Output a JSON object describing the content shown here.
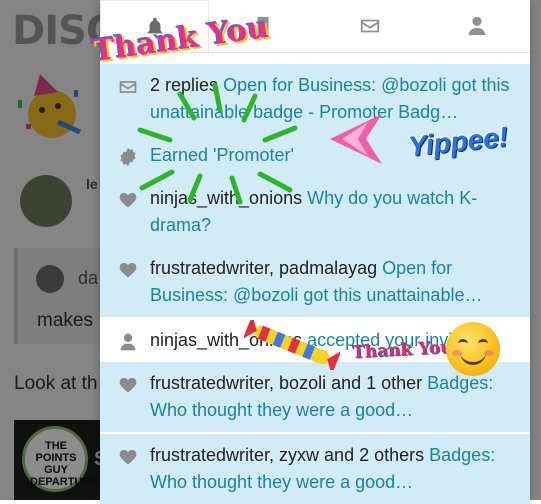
{
  "background": {
    "logo": "DISC",
    "author_partial": "le",
    "quote_author_partial": "da",
    "makes_text": "makes",
    "lookat_text": "Look at th",
    "points_guy_text": "THE POINTS GUY DEPARTURES",
    "extra_letter": "S"
  },
  "tabs": [
    {
      "name": "notifications",
      "icon": "bell-icon",
      "active": true
    },
    {
      "name": "bookmarks",
      "icon": "bookmark-icon",
      "active": false
    },
    {
      "name": "messages",
      "icon": "envelope-icon",
      "active": false
    },
    {
      "name": "profile",
      "icon": "user-icon",
      "active": false
    }
  ],
  "notifications": [
    {
      "icon": "envelope-icon",
      "who": "2 replies",
      "text": "Open for Business: @bozoli got this unattainable badge - Promoter Badg…",
      "unread": true
    },
    {
      "icon": "badge-icon",
      "who": "",
      "text": "Earned 'Promoter'",
      "unread": true
    },
    {
      "icon": "heart-icon",
      "who": "ninjas_with_onions",
      "text": "Why do you watch K-drama?",
      "unread": true
    },
    {
      "icon": "heart-icon",
      "who": "frustratedwriter, padmalayag",
      "text": "Open for Business: @bozoli got this unattainable…",
      "unread": true
    },
    {
      "icon": "user-icon",
      "who": "ninjas_with_onions",
      "text": "accepted your invitation",
      "unread": false
    },
    {
      "icon": "heart-icon",
      "who": "frustratedwriter, bozoli and 1 other",
      "text": "Badges: Who thought they were a good…",
      "unread": true
    },
    {
      "icon": "heart-icon",
      "who": "frustratedwriter, zyxw and 2 others",
      "text": "Badges: Who thought they were a good…",
      "unread": true
    }
  ],
  "stickers": {
    "thank_you_top": "Thank You",
    "yippee": "Yippee!",
    "thank_you_bottom": "Thank You"
  },
  "colors": {
    "unread_bg": "#d1ebf7",
    "link": "#1a84a0"
  }
}
